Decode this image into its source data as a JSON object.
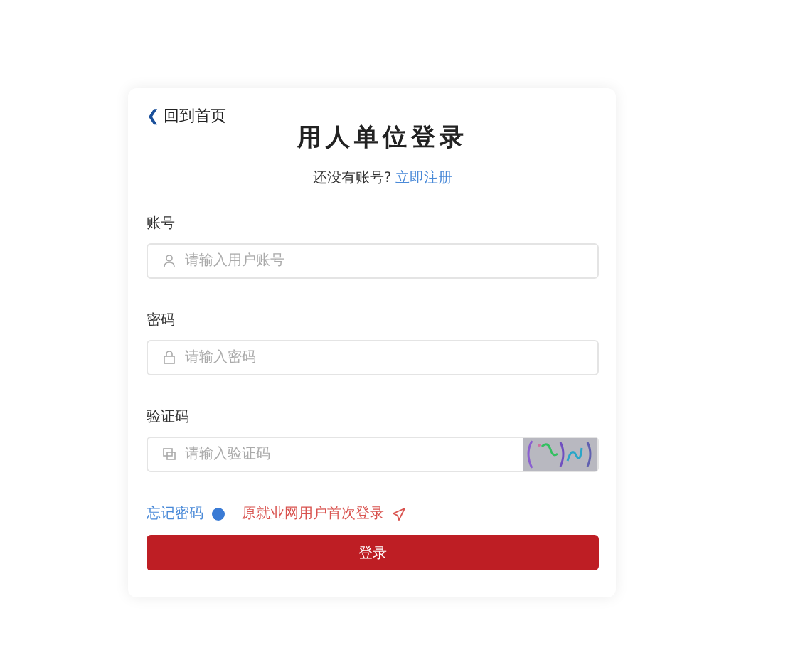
{
  "back_link": {
    "icon": "❮",
    "label": "回到首页"
  },
  "title": "用人单位登录",
  "register_prompt": {
    "text": "还没有账号?",
    "link": "立即注册"
  },
  "fields": [
    {
      "kind": "user",
      "label": "账号",
      "placeholder": "请输入用户账号"
    },
    {
      "kind": "lock",
      "label": "密码",
      "placeholder": "请输入密码"
    },
    {
      "kind": "captcha",
      "label": "验证码",
      "placeholder": "请输入验证码"
    }
  ],
  "forgot_link": "忘记密码",
  "first_login_link": "原就业网用户首次登录",
  "submit": "登录"
}
